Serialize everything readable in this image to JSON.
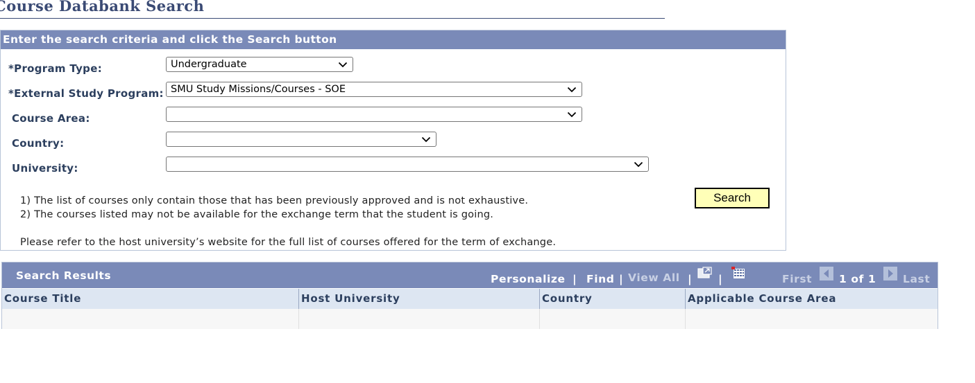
{
  "page": {
    "title": "Course Databank Search"
  },
  "criteria": {
    "header": "Enter the search criteria and click the Search button",
    "fields": [
      {
        "label": "*Program Type:",
        "value": "Undergraduate"
      },
      {
        "label": "*External Study Program:",
        "value": "SMU Study Missions/Courses - SOE"
      },
      {
        "label": "Course Area:",
        "value": ""
      },
      {
        "label": "Country:",
        "value": ""
      },
      {
        "label": "University:",
        "value": ""
      }
    ],
    "notes": [
      "1) The list of courses only contain those that has been previously approved and is not exhaustive.",
      "2) The courses listed may not be available for the exchange term that the student is going.",
      "Please refer to the host university’s website for the full list of courses offered for the term of exchange."
    ],
    "search_label": "Search"
  },
  "results": {
    "title": "Search Results",
    "personalize": "Personalize",
    "find": "Find",
    "view_all": "View All",
    "sep": "|",
    "first": "First",
    "page_info": "1 of 1",
    "last": "Last",
    "columns": [
      "Course Title",
      "Host University",
      "Country",
      "Applicable Course Area"
    ],
    "rows": []
  },
  "colors": {
    "header_bg": "#7a8ab8",
    "title_text": "#3a4a74",
    "column_header_bg": "#dde6f2",
    "search_button_bg": "#ffffb8"
  },
  "icons": {
    "select_arrow": "chevron-down-icon",
    "new_window": "new-window-icon",
    "download": "grid-download-icon",
    "first_page": "arrow-left-icon",
    "last_page": "arrow-right-icon"
  }
}
